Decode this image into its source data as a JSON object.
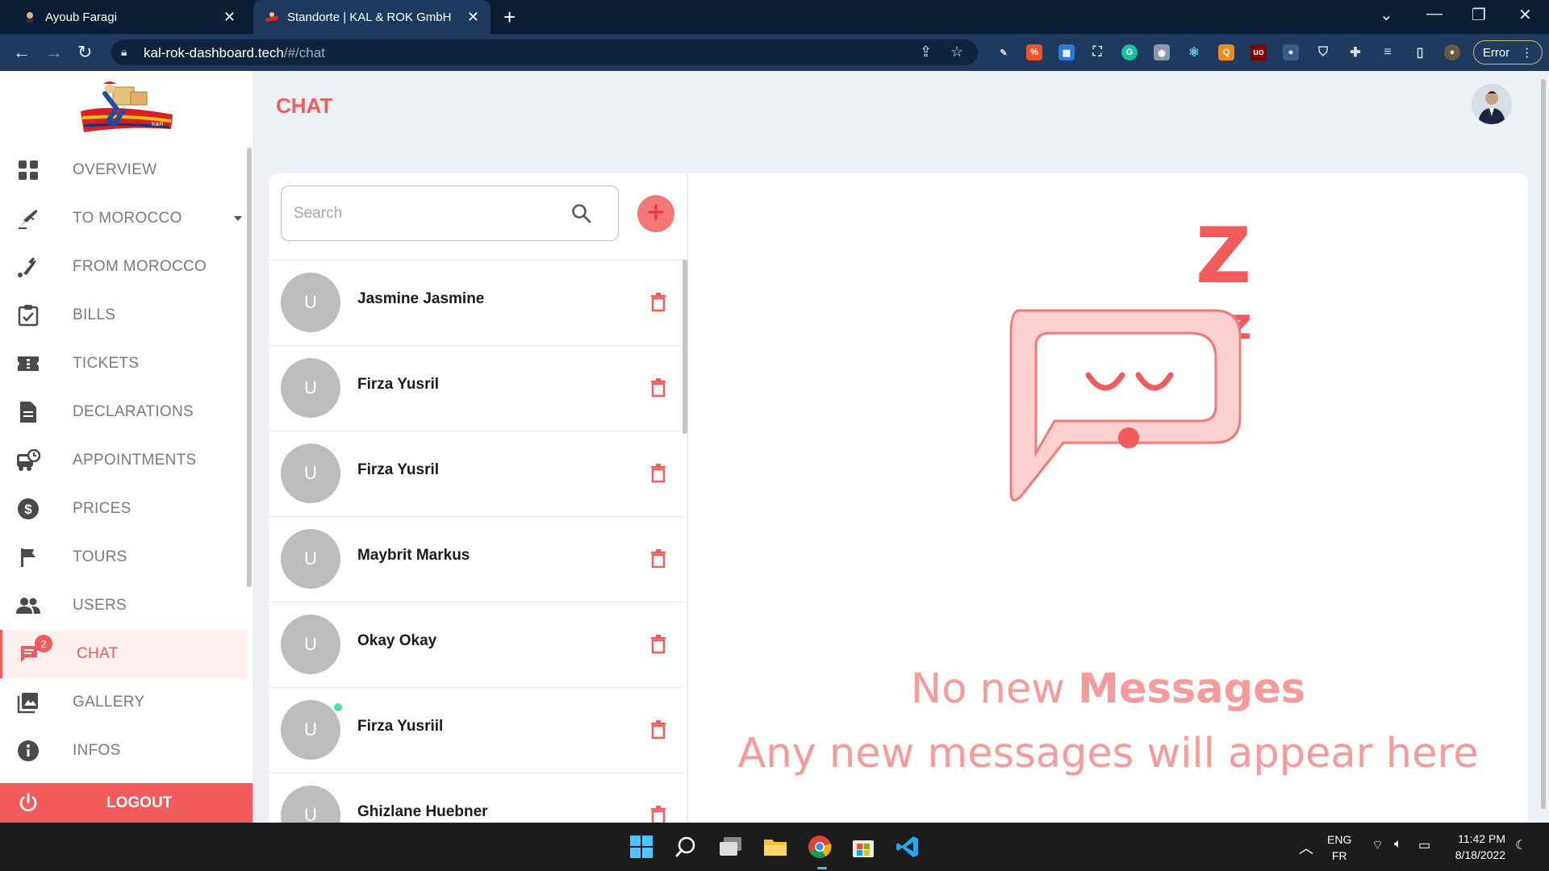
{
  "browser": {
    "tabs": [
      {
        "title": "Ayoub Faragi"
      },
      {
        "title": "Standorte | KAL & ROK GmbH"
      }
    ],
    "url_host": "kal-rok-dashboard.tech",
    "url_path": "/#/chat",
    "profile_button": "Error"
  },
  "sidebar": {
    "items": [
      {
        "label": "OVERVIEW",
        "icon": "grid-icon"
      },
      {
        "label": "TO MOROCCO",
        "icon": "plane-departure-icon"
      },
      {
        "label": "FROM MOROCCO",
        "icon": "plane-arrival-icon"
      },
      {
        "label": "BILLS",
        "icon": "clipboard-check-icon"
      },
      {
        "label": "TICKETS",
        "icon": "ticket-icon"
      },
      {
        "label": "DECLARATIONS",
        "icon": "document-icon"
      },
      {
        "label": "APPOINTMENTS",
        "icon": "bus-clock-icon"
      },
      {
        "label": "PRICES",
        "icon": "dollar-icon"
      },
      {
        "label": "TOURS",
        "icon": "flag-icon"
      },
      {
        "label": "USERS",
        "icon": "users-icon"
      },
      {
        "label": "CHAT",
        "icon": "chat-icon",
        "badge": "2"
      },
      {
        "label": "GALLERY",
        "icon": "image-icon"
      },
      {
        "label": "INFOS",
        "icon": "info-icon"
      }
    ],
    "logout": "LOGOUT"
  },
  "header": {
    "title": "CHAT"
  },
  "chat": {
    "search_placeholder": "Search",
    "conversations": [
      {
        "initial": "U",
        "name": "Jasmine Jasmine",
        "online": false
      },
      {
        "initial": "U",
        "name": "Firza Yusril",
        "online": false
      },
      {
        "initial": "U",
        "name": "Firza Yusril",
        "online": false
      },
      {
        "initial": "U",
        "name": "Maybrit Markus",
        "online": false
      },
      {
        "initial": "U",
        "name": "Okay Okay",
        "online": false
      },
      {
        "initial": "U",
        "name": "Firza Yusriil",
        "online": true
      },
      {
        "initial": "U",
        "name": "Ghizlane Huebner",
        "online": false
      }
    ],
    "empty_line1_prefix": "No new ",
    "empty_line1_bold": "Messages",
    "empty_line2": "Any new messages will appear here"
  },
  "taskbar": {
    "lang_top": "ENG",
    "lang_bottom": "FR",
    "time": "11:42 PM",
    "date": "8/18/2022"
  },
  "colors": {
    "accent": "#f25b5b",
    "accent_light": "#f69a9a",
    "chrome_dark": "#0b1e33",
    "chrome_bar": "#1e3a5f"
  }
}
